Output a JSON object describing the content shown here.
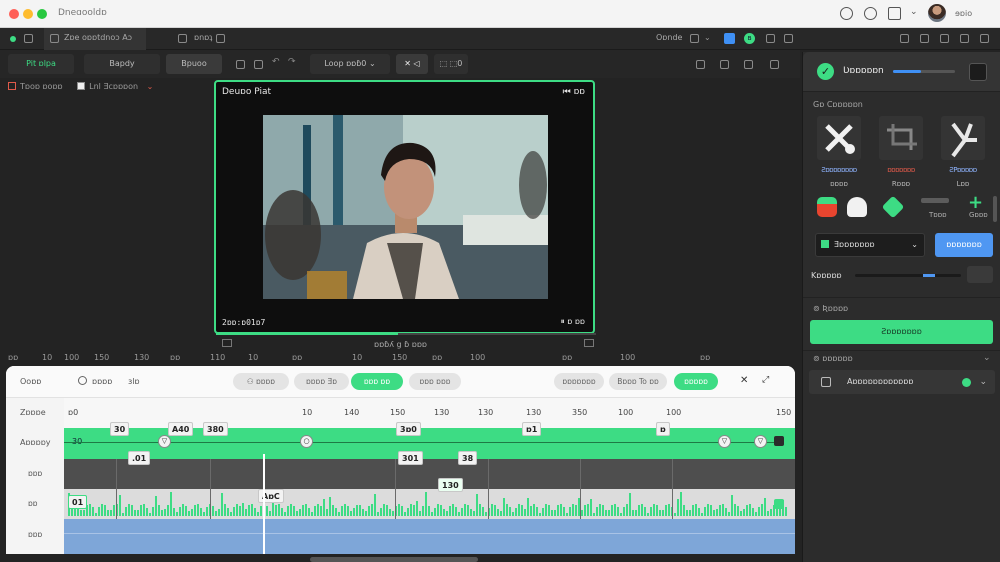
{
  "window": {
    "title": "Dneɑooldɒ",
    "user_name": "ɘɒio",
    "traffic_colors": [
      "#ff5f57",
      "#febc2e",
      "#28c840"
    ]
  },
  "toolbar1": {
    "tab_label": "Zɒe oɒɒtdnoɔ Aɔ",
    "center_label": "ɒnɒʇ",
    "right_label": "Oɒnde",
    "badge": "ʙ"
  },
  "toolbar2": {
    "tab1": "Pit ɒlpa",
    "tab2": "Bapdy",
    "tab3": "Bpuoo",
    "dropdown": "Loop  ɒɒɓ0 ⌄",
    "close_label": "✕ ◁",
    "small": "⬚ ⬚0"
  },
  "options": {
    "opt1": "Tɒoɒ ɒoɒɒ",
    "opt2": "Lnl Ǝcɒɒɒon"
  },
  "preview": {
    "title": "Deuɒo Piat",
    "timecode": "2ɒɒ:ɒ01ɒ7",
    "controls_top": "⏮ ɒɒ",
    "controls_bottom": "⏸ ɒ ɒɒ",
    "progress_fraction": 0.48,
    "below_label": "ɒɒɓʎ g ɓ  ɒɒɒ"
  },
  "ruler_top": {
    "labels": [
      "ɒɒ",
      "10",
      "100",
      "150",
      "130",
      "ɒɒ",
      "110",
      "10",
      "ɒɒ",
      "10",
      "150",
      "ɒɒ",
      "100",
      "ɒɒ",
      "100",
      "ɒɒ"
    ]
  },
  "timeline": {
    "side_labels": [
      "Ooɒɒ",
      "Zɒɒɒe",
      "Aɒɒɒɒy"
    ],
    "search_label": "ɒɒɒɒ",
    "mid_label": "ɜlɒ",
    "pills": [
      "⚇ ɒɒɒɒ",
      "ɒɒɒɒ Ǝɒ",
      "ɒɒɒ ɒɒ",
      "ɒɒɒ ɒɒɒ",
      "ɒɒɒɒɒɒɒ",
      "Bɒɒɒ To ɒɒ",
      "ɒɒɒɒɒ"
    ],
    "ruler": [
      "ɒ0",
      "10",
      "140",
      "150",
      "130",
      "130",
      "130",
      "350",
      "100",
      "100",
      "150"
    ],
    "chips": {
      "c1": "30",
      "c2": "A40",
      "c3": "380",
      "c4": "3ɒ0",
      "c5": "ɒ1",
      "c6": "ɒ",
      "c7": ".01",
      "c8": "301",
      "c9": "38",
      "c10": "130",
      "c11": "AɒC",
      "c12": "01"
    },
    "row_labels": [
      "ɒɒɒ",
      "ɒɒ",
      "ɒɒɒ"
    ],
    "track_label": "30"
  },
  "panel": {
    "title": "Ʋɒɒɒɒɒn",
    "section1": "Gɒ Cɒɒɒɒɒn",
    "tools": [
      {
        "name": "Ƨɒɒɒɒɒɒɒɒ",
        "sub": "ɒɒɒɒ"
      },
      {
        "name": "ɒɒɒɒɒɒɒ",
        "sub": "Rɒɒɒ"
      },
      {
        "name": "ƧPɒɒɒɒɒ",
        "sub": "Lɒɒ"
      }
    ],
    "mini_labels": [
      "Tɒɒɒ",
      "Gɒɒɒ"
    ],
    "dropdown": "Ǝɒɒɒɒɒɒɒ",
    "blue_button": "ɒɒɒɒɒɒɒ",
    "range_label": "Kɒɒɒɒɒ",
    "range_fraction": 0.72,
    "section2": "⊚ Ʀɒɒɒɒ",
    "green_button": "Ƨɒɒɒɒɒɒɒ",
    "section3": "⊚ ɒɒɒɒɒɒ",
    "row_label": "Aɒɒɒɒɒɒɒɒɒɒɒɒ",
    "colors": {
      "accent": "#3ddc84",
      "blue": "#4f97f2"
    }
  }
}
